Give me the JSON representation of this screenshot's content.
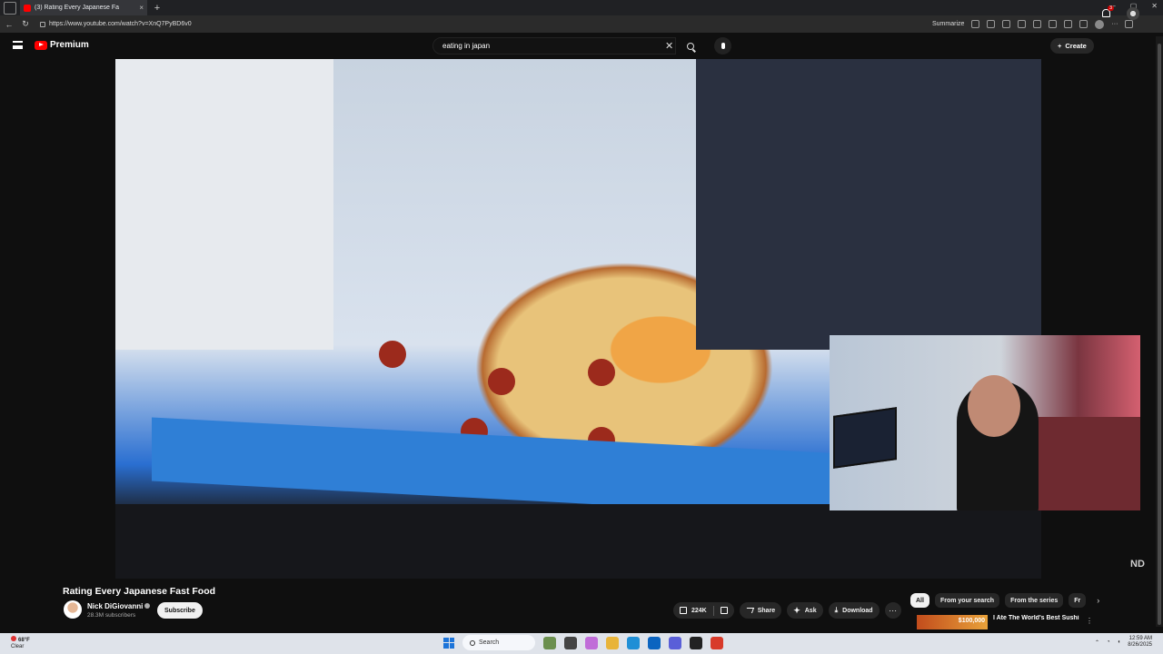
{
  "browser": {
    "tab_title": "(3) Rating Every Japanese Fa",
    "tab_close": "×",
    "new_tab": "+",
    "url": "https://www.youtube.com/watch?v=XnQ7PyBD6v0",
    "summarize": "Summarize",
    "window_min": "–",
    "window_max": "▢",
    "window_close": "✕"
  },
  "youtube": {
    "logo_text": "Premium",
    "search_query": "eating in japan",
    "search_clear": "✕",
    "create_label": "Create",
    "notification_count": "3"
  },
  "video": {
    "watermark": "ND",
    "title": "Rating Every Japanese Fast Food",
    "channel_name": "Nick DiGiovanni",
    "subscribers": "28.3M subscribers",
    "subscribe_label": "Subscribe",
    "likes": "224K",
    "share_label": "Share",
    "ask_label": "Ask",
    "download_label": "Download",
    "more_label": "···"
  },
  "chips": [
    {
      "label": "All",
      "active": true
    },
    {
      "label": "From your search"
    },
    {
      "label": "From the series"
    },
    {
      "label": "Fr"
    }
  ],
  "chips_next": "›",
  "related": {
    "thumb_text": "$100,000",
    "title": "I Ate The World's Best Sushi",
    "more": "⋮"
  },
  "taskbar": {
    "weather_temp": "68°F",
    "weather_cond": "Clear",
    "weather_alert": "3",
    "search_label": "Search",
    "time": "12:59 AM",
    "date": "8/26/2025"
  },
  "colors": {
    "yt_red": "#ff0000",
    "bg": "#0f0f0f",
    "pill": "#272727"
  }
}
